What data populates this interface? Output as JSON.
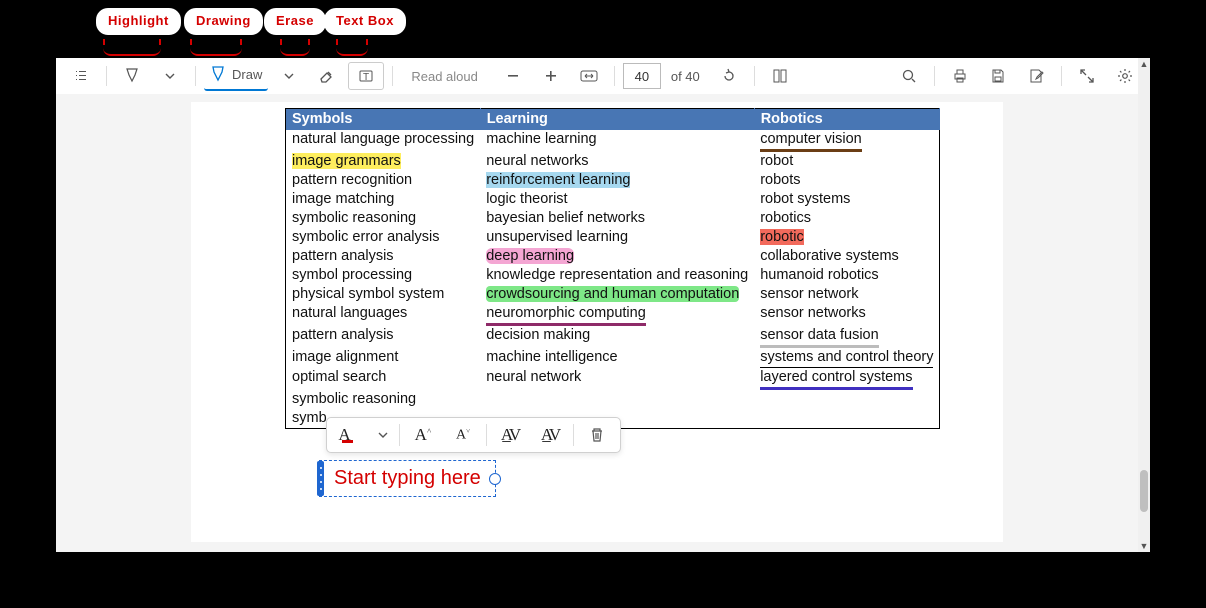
{
  "annotations": {
    "highlight": "Highlight",
    "drawing": "Drawing",
    "erase": "Erase",
    "textbox": "Text Box"
  },
  "toolbar": {
    "draw_label": "Draw",
    "read_aloud_label": "Read aloud",
    "page_current": "40",
    "page_total": "of 40"
  },
  "table": {
    "headers": [
      "Symbols",
      "Learning",
      "Robotics"
    ],
    "rows": [
      [
        "natural language processing",
        "machine learning",
        "computer vision"
      ],
      [
        "image grammars",
        "neural networks",
        "robot"
      ],
      [
        "pattern recognition",
        "reinforcement learning",
        "robots"
      ],
      [
        "image matching",
        "logic theorist",
        "robot systems"
      ],
      [
        "symbolic reasoning",
        "bayesian belief networks",
        "robotics"
      ],
      [
        "symbolic error analysis",
        "unsupervised learning",
        "robotic"
      ],
      [
        "pattern analysis",
        "deep learning",
        "collaborative systems"
      ],
      [
        "symbol processing",
        "knowledge representation and reasoning",
        "humanoid robotics"
      ],
      [
        "physical symbol system",
        "crowdsourcing and human computation",
        "sensor network"
      ],
      [
        "natural languages",
        "neuromorphic computing",
        "sensor networks"
      ],
      [
        "pattern analysis",
        "decision making",
        "sensor data fusion"
      ],
      [
        "image alignment",
        "machine intelligence",
        "systems and control theory"
      ],
      [
        "optimal search",
        "neural network",
        "layered control systems"
      ],
      [
        "symbolic reasoning",
        "",
        ""
      ],
      [
        "symb",
        "",
        ""
      ]
    ]
  },
  "textbox": {
    "placeholder": "Start typing here"
  }
}
